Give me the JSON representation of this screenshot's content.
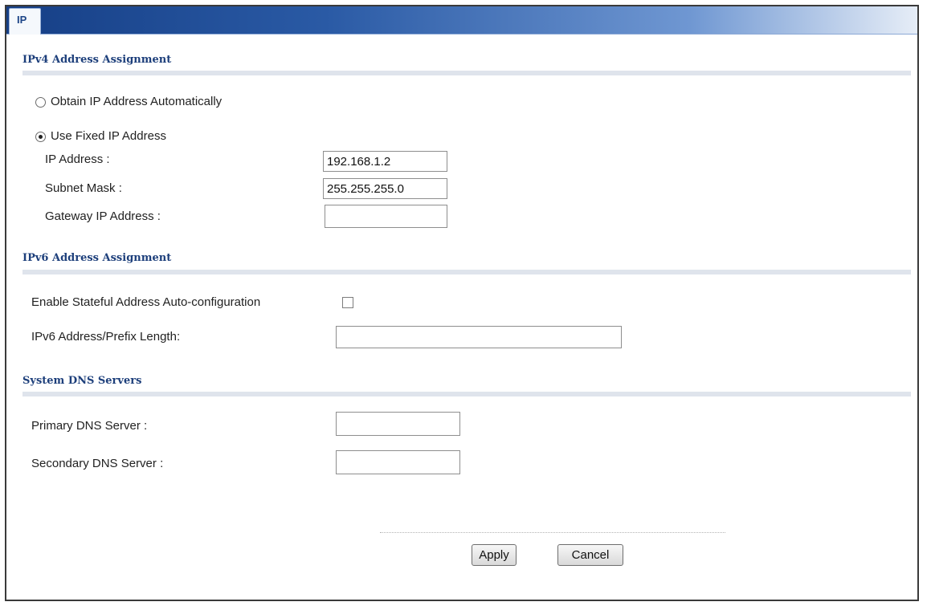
{
  "tab": {
    "label": "IP"
  },
  "ipv4": {
    "title": "IPv4 Address Assignment",
    "obtain_auto_label": "Obtain IP Address Automatically",
    "use_fixed_label": "Use Fixed IP Address",
    "ip_address_label": "IP Address :",
    "ip_address_value": "192.168.1.2",
    "subnet_mask_label": "Subnet Mask :",
    "subnet_mask_value": "255.255.255.0",
    "gateway_label": "Gateway IP Address :",
    "gateway_value": ""
  },
  "ipv6": {
    "title": "IPv6 Address Assignment",
    "stateful_label": "Enable Stateful Address Auto-configuration",
    "prefix_label": "IPv6 Address/Prefix Length:",
    "prefix_value": ""
  },
  "dns": {
    "title": "System DNS Servers",
    "primary_label": "Primary DNS Server :",
    "primary_value": "",
    "secondary_label": "Secondary DNS Server :",
    "secondary_value": ""
  },
  "actions": {
    "apply": "Apply",
    "cancel": "Cancel"
  }
}
